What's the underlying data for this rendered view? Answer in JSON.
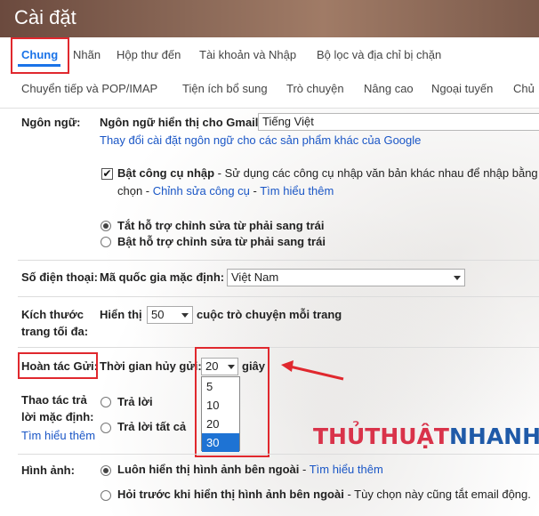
{
  "header": {
    "title": "Cài đặt"
  },
  "tabs_row1": [
    {
      "label": "Chung"
    },
    {
      "label": "Nhãn"
    },
    {
      "label": "Hộp thư đến"
    },
    {
      "label": "Tài khoản và Nhập"
    },
    {
      "label": "Bộ lọc và địa chỉ bị chặn"
    }
  ],
  "tabs_row2": [
    {
      "label": "Chuyển tiếp và POP/IMAP"
    },
    {
      "label": "Tiện ích bổ sung"
    },
    {
      "label": "Trò chuyện"
    },
    {
      "label": "Nâng cao"
    },
    {
      "label": "Ngoại tuyến"
    },
    {
      "label": "Chủ"
    }
  ],
  "language": {
    "label": "Ngôn ngữ:",
    "display_label": "Ngôn ngữ hiển thị cho Gmail:",
    "display_value": "Tiếng Việt",
    "change_link": "Thay đổi cài đặt ngôn ngữ cho các sản phẩm khác của Google",
    "input_tools_label": "Bật công cụ nhập",
    "input_tools_desc": " - Sử dụng các công cụ nhập văn bản khác nhau để nhập bằng",
    "input_tools_line2_prefix": "chọn - ",
    "edit_tools_link": "Chỉnh sửa công cụ",
    "sep": " - ",
    "learn_more": "Tìm hiểu thêm",
    "rtl_off": "Tắt hỗ trợ chỉnh sửa từ phải sang trái",
    "rtl_on": "Bật hỗ trợ chỉnh sửa từ phải sang trái"
  },
  "phone": {
    "label": "Số điện thoại:",
    "country_label": "Mã quốc gia mặc định:",
    "country_value": "Việt Nam"
  },
  "page_size": {
    "label_line1": "Kích thước",
    "label_line2": "trang tối đa:",
    "show_label": "Hiển thị",
    "value": "50",
    "suffix": "cuộc trò chuyện mỗi trang"
  },
  "undo_send": {
    "label": "Hoàn tác Gửi:",
    "period_label": "Thời gian hủy gửi:",
    "value": "20",
    "unit": "giây",
    "options": [
      "5",
      "10",
      "20",
      "30"
    ],
    "highlighted_option": "30"
  },
  "reply": {
    "label_line1": "Thao tác trả",
    "label_line2": "lời mặc định:",
    "learn_more": "Tìm hiểu thêm",
    "reply": "Trả lời",
    "reply_all": "Trả lời tất cả"
  },
  "images": {
    "label": "Hình ảnh:",
    "always_show": "Luôn hiển thị hình ảnh bên ngoài",
    "sep": " - ",
    "learn_more": "Tìm hiểu thêm",
    "ask_before": "Hỏi trước khi hiển thị hình ảnh bên ngoài",
    "ask_desc": " - Tùy chọn này cũng tắt email động."
  },
  "watermark": {
    "part1": "THỦTHUẬT",
    "part2": "NHANH"
  },
  "colors": {
    "accent": "#1a73e8",
    "link": "#1a56c6",
    "highlight_red": "#e0282e",
    "selected_option": "#1e73d4"
  }
}
